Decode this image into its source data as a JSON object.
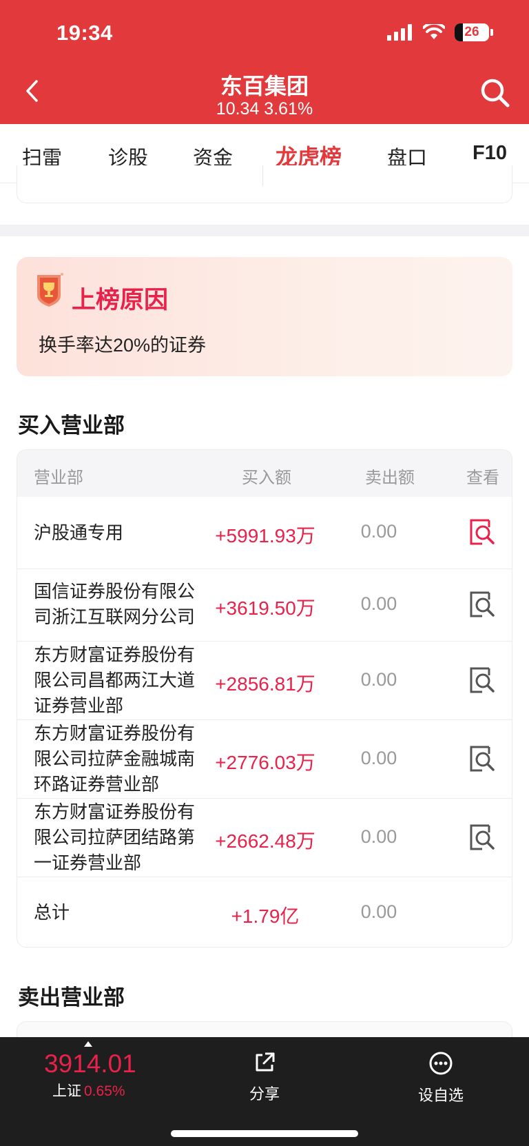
{
  "status_bar": {
    "time": "19:34",
    "battery": "26"
  },
  "header": {
    "title": "东百集团",
    "subtitle": "10.34 3.61%"
  },
  "tabs": [
    {
      "label": "扫雷"
    },
    {
      "label": "诊股"
    },
    {
      "label": "资金"
    },
    {
      "label": "龙虎榜",
      "active": true
    },
    {
      "label": "盘口"
    },
    {
      "label": "F10"
    }
  ],
  "reason": {
    "title": "上榜原因",
    "text": "换手率达20%的证券"
  },
  "buy_section": {
    "title": "买入营业部",
    "headers": {
      "dept": "营业部",
      "buy": "买入额",
      "sell": "卖出额",
      "view": "查看"
    },
    "rows": [
      {
        "name": "沪股通专用",
        "buy": "+5991.93万",
        "sell": "0.00",
        "highlight": true
      },
      {
        "name": "国信证券股份有限公司浙江互联网分公司",
        "buy": "+3619.50万",
        "sell": "0.00"
      },
      {
        "name": "东方财富证券股份有限公司昌都两江大道证券营业部",
        "buy": "+2856.81万",
        "sell": "0.00"
      },
      {
        "name": "东方财富证券股份有限公司拉萨金融城南环路证券营业部",
        "buy": "+2776.03万",
        "sell": "0.00"
      },
      {
        "name": "东方财富证券股份有限公司拉萨团结路第一证券营业部",
        "buy": "+2662.48万",
        "sell": "0.00"
      }
    ],
    "total": {
      "label": "总计",
      "buy": "+1.79亿",
      "sell": "0.00"
    }
  },
  "sell_section": {
    "title": "卖出营业部"
  },
  "bottom_bar": {
    "index_value": "3914.01",
    "index_name": "上证",
    "index_change": "0.65%",
    "share_label": "分享",
    "watchlist_label": "设自选"
  },
  "colors": {
    "brand_red": "#e23a3c",
    "up_red": "#e8224a"
  },
  "icons": [
    "back-icon",
    "search-icon",
    "medal-icon",
    "view-detail-icon",
    "share-icon",
    "more-icon"
  ]
}
